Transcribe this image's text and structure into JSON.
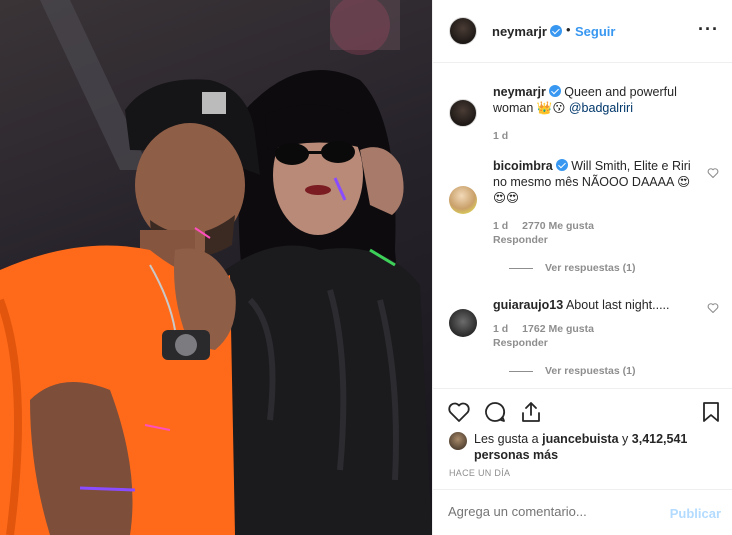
{
  "post": {
    "author": "neymarjr",
    "separator": "•",
    "follow_label": "Seguir",
    "more_icon": "more-options-icon",
    "more_glyph": "···"
  },
  "caption": {
    "username": "neymarjr",
    "text": "Queen and powerful woman 👑😗",
    "mention": "@badgalriri",
    "age": "1 d"
  },
  "comments": [
    {
      "username": "bicoimbra",
      "verified": true,
      "text": "Will Smith, Elite e Riri no mesmo mês NÃOOO DAAAA 😍😍😍",
      "age": "1 d",
      "likes": "2770 Me gusta",
      "reply_label": "Responder",
      "view_replies": "Ver respuestas (1)"
    },
    {
      "username": "guiaraujo13",
      "verified": false,
      "text": "About last night.....",
      "age": "1 d",
      "likes": "1762 Me gusta",
      "reply_label": "Responder",
      "view_replies": "Ver respuestas (1)"
    }
  ],
  "likes": {
    "prefix": "Les gusta a",
    "user": "juancebuista",
    "conj": "y",
    "count": "3,412,541 personas más"
  },
  "timestamp": "HACE UN DÍA",
  "add_comment": {
    "placeholder": "Agrega un comentario...",
    "post_label": "Publicar"
  },
  "colors": {
    "accent": "#3897f0",
    "post_disabled": "#b3dbff",
    "shirt": "#ff6a1a"
  }
}
